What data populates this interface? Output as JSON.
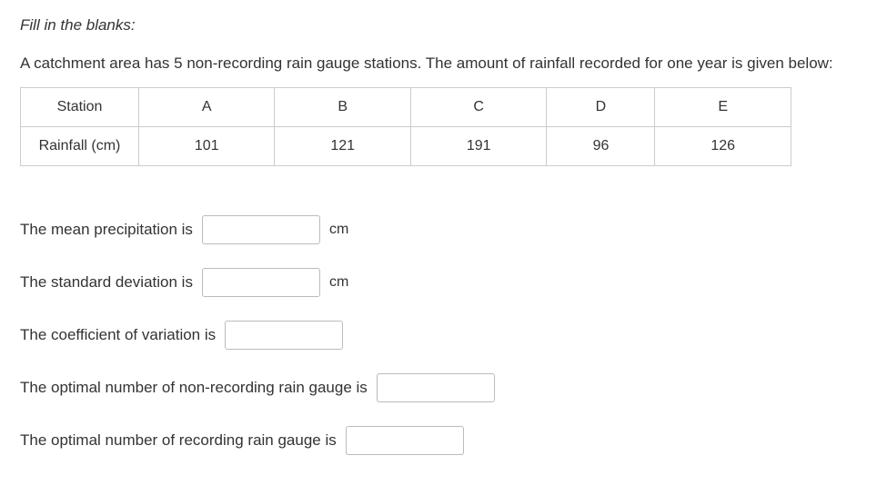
{
  "instruction": "Fill in the blanks:",
  "description": "A catchment area has 5 non-recording rain gauge stations. The amount of rainfall recorded for one year is given below:",
  "table": {
    "header_label": "Station",
    "row_label": "Rainfall (cm)",
    "stations": [
      "A",
      "B",
      "C",
      "D",
      "E"
    ],
    "values": [
      "101",
      "121",
      "191",
      "96",
      "126"
    ]
  },
  "questions": {
    "q1": {
      "label": "The mean precipitation is",
      "unit": "cm",
      "value": ""
    },
    "q2": {
      "label": "The standard deviation is",
      "unit": "cm",
      "value": ""
    },
    "q3": {
      "label": "The coefficient of variation is",
      "value": ""
    },
    "q4": {
      "label": "The optimal number of non-recording  rain gauge is",
      "value": ""
    },
    "q5": {
      "label": "The optimal number of recording  rain gauge is",
      "value": ""
    }
  }
}
